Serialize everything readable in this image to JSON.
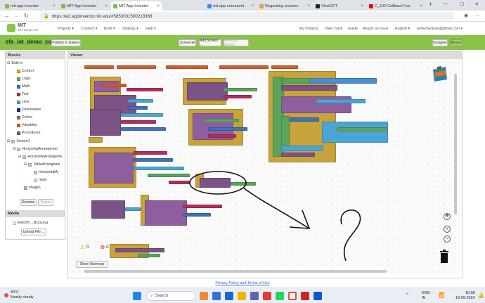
{
  "tabs": [
    {
      "label": "mit app inventor -",
      "color": "#7cbf3a"
    },
    {
      "label": "MIT App Inventor",
      "color": "#7cbf3a"
    },
    {
      "label": "MIT App Inventor",
      "color": "#7cbf3a"
    },
    {
      "label": "mit app communit",
      "color": "#4285f4"
    },
    {
      "label": "Regarding reconne",
      "color": "#e8a43a"
    },
    {
      "label": "ChatGPT",
      "color": "#222222"
    },
    {
      "label": "C_102 Callback Fun",
      "color": "#ff0000"
    }
  ],
  "url": "https://ai2.appinventor.mit.edu/#5853031500218368",
  "logo": {
    "line1": "MIT",
    "line2": "APP INVENTOR"
  },
  "menus": [
    "Projects",
    "Connect",
    "Build",
    "Settings",
    "Help"
  ],
  "right_menus": [
    "My Projects",
    "View Trash",
    "Guide",
    "Report an Issue",
    "English"
  ],
  "user_email": "perfectaranan@gmail.com",
  "project": {
    "name": "efx_iot_demo_copy",
    "publish": "Publish to Gallery",
    "screen": "Screen1",
    "add_screen": "Add Screen ...",
    "remove_screen": "Remove Screen",
    "designer": "Designer",
    "blocks": "Blocks"
  },
  "blocks_panel": {
    "title": "Blocks",
    "builtin": "Built-in",
    "items": [
      {
        "label": "Control",
        "color": "#e1a91a"
      },
      {
        "label": "Logic",
        "color": "#77ab41"
      },
      {
        "label": "Math",
        "color": "#3f71b5"
      },
      {
        "label": "Text",
        "color": "#b32d5e"
      },
      {
        "label": "Lists",
        "color": "#49a6d4"
      },
      {
        "label": "Dictionaries",
        "color": "#2d1799"
      },
      {
        "label": "Colors",
        "color": "#7d7d7d"
      },
      {
        "label": "Variables",
        "color": "#d05f2d"
      },
      {
        "label": "Procedures",
        "color": "#7c5385"
      }
    ],
    "components": [
      "Screen1",
      "HorizontalArrangemer",
      "HorizontalArrangeme",
      "TableArrangeme",
      "HorizontalAr",
      "reset",
      "Image1"
    ],
    "rename": "Rename",
    "delete": "Delete"
  },
  "media": {
    "title": "Media",
    "file": "Electrif-...-8(1).png",
    "upload": "Upload File ..."
  },
  "viewer": {
    "title": "Viewer"
  },
  "warnings": {
    "warn_count": "0",
    "error_count": "0",
    "button": "Show Warnings"
  },
  "footer_link": "Privacy Policy and Terms of Use",
  "taskbar": {
    "temp": "30°C",
    "weather": "Mostly cloudy",
    "search": "Search",
    "lang1": "ENG",
    "lang2": "IN",
    "time": "15:08",
    "date": "19-09-2023"
  }
}
